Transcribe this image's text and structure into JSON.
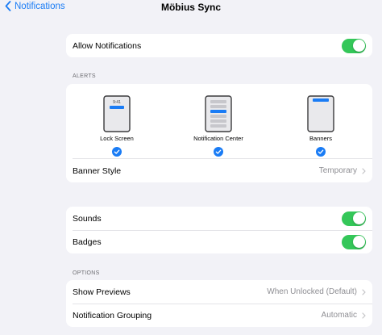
{
  "nav": {
    "back_label": "Notifications",
    "title": "Möbius Sync"
  },
  "allow": {
    "label": "Allow Notifications",
    "on": true
  },
  "alerts": {
    "section": "ALERTS",
    "options": [
      {
        "label": "Lock Screen",
        "checked": true,
        "time": "9:41"
      },
      {
        "label": "Notification Center",
        "checked": true
      },
      {
        "label": "Banners",
        "checked": true
      }
    ],
    "banner_style": {
      "label": "Banner Style",
      "value": "Temporary"
    }
  },
  "sounds": {
    "label": "Sounds",
    "on": true
  },
  "badges": {
    "label": "Badges",
    "on": true
  },
  "options": {
    "section": "OPTIONS",
    "show_previews": {
      "label": "Show Previews",
      "value": "When Unlocked (Default)"
    },
    "grouping": {
      "label": "Notification Grouping",
      "value": "Automatic"
    }
  },
  "colors": {
    "accent": "#1a7cf5",
    "toggle_on": "#34c759",
    "background": "#f2f2f7"
  }
}
